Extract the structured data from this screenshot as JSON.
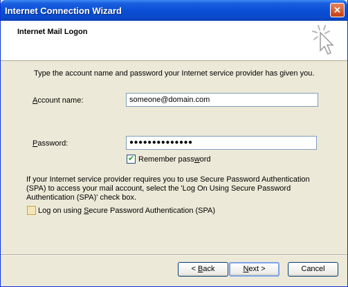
{
  "window": {
    "title": "Internet Connection Wizard"
  },
  "header": {
    "title": "Internet Mail Logon"
  },
  "intro": "Type the account name and password your Internet service provider has given you.",
  "account": {
    "label_pre": "",
    "label_ul": "A",
    "label_post": "ccount name:",
    "value": "someone@domain.com"
  },
  "password": {
    "label_pre": "",
    "label_ul": "P",
    "label_post": "assword:",
    "value": "●●●●●●●●●●●●●●"
  },
  "remember": {
    "label_pre": "Remember pass",
    "label_ul": "w",
    "label_post": "ord",
    "checked": true
  },
  "spa_text": "If your Internet service provider requires you to use Secure Password Authentication (SPA) to access your mail account, select the 'Log On Using Secure Password Authentication (SPA)' check box.",
  "spa_check": {
    "label_pre": "Log on using ",
    "label_ul": "S",
    "label_post": "ecure Password Authentication (SPA)",
    "checked": false
  },
  "buttons": {
    "back": {
      "pre": "< ",
      "ul": "B",
      "post": "ack"
    },
    "next": {
      "pre": "",
      "ul": "N",
      "post": "ext >"
    },
    "cancel": "Cancel"
  }
}
